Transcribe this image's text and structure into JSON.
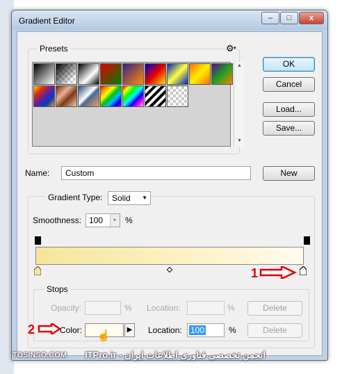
{
  "window": {
    "title": "Gradient Editor",
    "controls": {
      "minimize": "–",
      "maximize": "□",
      "close": "x"
    }
  },
  "presets": {
    "label": "Presets",
    "menu_icon": "gear-icon",
    "swatch_icons": [
      "black-to-white",
      "fg-to-transparent",
      "black-white",
      "red-green",
      "violet-orange",
      "blue-red-yellow",
      "blue-yellow-blue",
      "orange-yellow-orange",
      "violet-green-orange",
      "yellow-violet-orange-blue",
      "copper",
      "chrome",
      "spectrum",
      "transparent-rainbow",
      "transparent-stripes",
      "checkerboard"
    ]
  },
  "buttons": {
    "ok": "OK",
    "cancel": "Cancel",
    "load": "Load...",
    "save": "Save...",
    "new": "New"
  },
  "name": {
    "label": "Name:",
    "value": "Custom"
  },
  "gradient_type": {
    "label": "Gradient Type:",
    "value": "Solid",
    "arrow": "▼"
  },
  "smoothness": {
    "label": "Smoothness:",
    "value": "100",
    "unit": "%",
    "stepper": "▸"
  },
  "stops": {
    "label": "Stops",
    "opacity": {
      "label": "Opacity:",
      "value": "",
      "unit": "%"
    },
    "opacity_location": {
      "label": "Location:",
      "value": "",
      "unit": "%"
    },
    "opacity_delete": "Delete",
    "color": {
      "label": "Color:",
      "value": "",
      "arrow": "▶"
    },
    "color_location": {
      "label": "Location:",
      "value": "100",
      "unit": "%"
    },
    "color_delete": "Delete"
  },
  "annotations": {
    "one": "1",
    "two": "2"
  },
  "watermark": {
    "left": "TOSINSO.COM",
    "right": "ITPro.ir - انجمن تخصصی فناوری اطلاعات ایران"
  },
  "colors": {
    "gradient_start": "#f6e59a",
    "gradient_end": "#fffbef",
    "annotation": "#e00000",
    "selection": "#3399ff"
  }
}
